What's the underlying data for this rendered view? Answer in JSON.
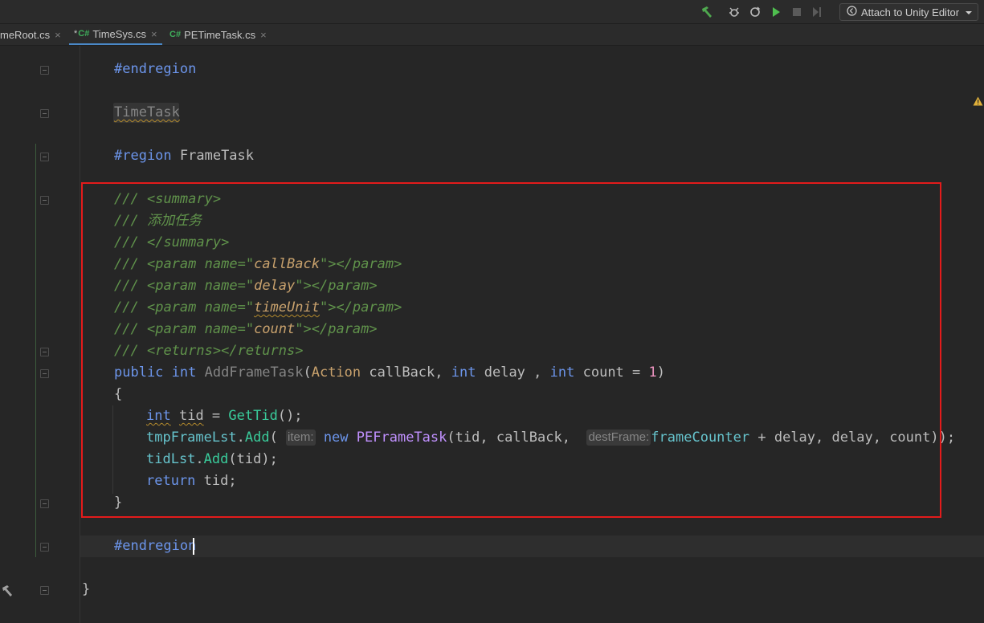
{
  "toolbar": {
    "buttons": [
      "build-icon",
      "debug-attach-icon",
      "refresh-icon",
      "run-icon",
      "stop-icon",
      "step-icon"
    ],
    "attach_label": "Attach to Unity Editor"
  },
  "tabs": [
    {
      "label": "meRoot.cs",
      "active": false,
      "modified": false
    },
    {
      "label": "TimeSys.cs",
      "active": true,
      "modified": true
    },
    {
      "label": "PETimeTask.cs",
      "active": false,
      "modified": false
    }
  ],
  "tab_icon_text": "C#",
  "tab_modified_mark": "*",
  "tab_close_glyph": "×",
  "code": {
    "l1": "#endregion",
    "l2": "TimeTask",
    "l3_kw": "#region",
    "l3_name": " FrameTask",
    "doc_prefix": "/// ",
    "summary_open": "summary",
    "summary_text": "添加任务",
    "summary_close": "summary",
    "param_tag": "param",
    "param_attr": "name",
    "params": [
      "callBack",
      "delay",
      "timeUnit",
      "count"
    ],
    "returns_tag": "returns",
    "sig": {
      "public": "public",
      "int": "int",
      "name": "AddFrameTask",
      "action": "Action",
      "p1": "callBack",
      "p2": "delay",
      "p3": "count",
      "default": "1"
    },
    "open_brace": "{",
    "close_brace": "}",
    "body1_var": "tid",
    "body1_call": "GetTid",
    "body2_obj": "tmpFrameLst",
    "body2_method": "Add",
    "hint_item": "item:",
    "new_kw": "new",
    "ctor": "PEFrameTask",
    "hint_dest": "destFrame:",
    "frame_counter": "frameCounter",
    "body3_obj": "tidLst",
    "return_kw": "return",
    "end_region": "#endregion",
    "class_close": "}"
  },
  "colors": {
    "keyword": "#6c95eb",
    "method": "#39cc9b",
    "doc": "#60934b",
    "string": "#c9a26d",
    "highlight_box": "#e31b1b"
  }
}
